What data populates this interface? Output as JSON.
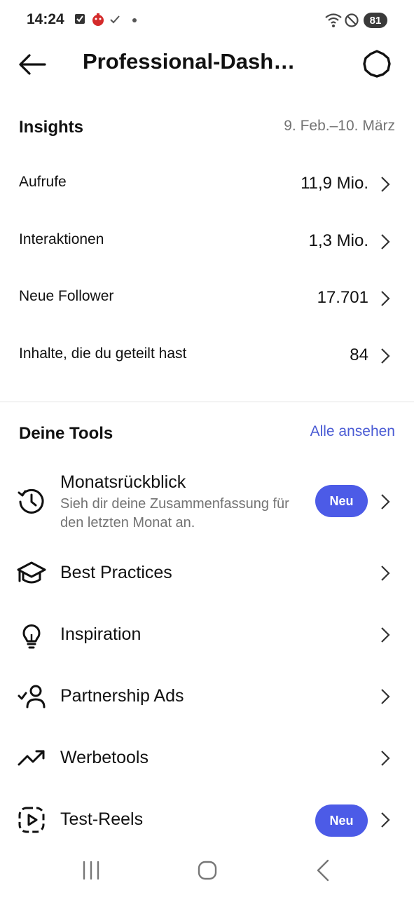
{
  "status_bar": {
    "time": "14:24",
    "battery": "81"
  },
  "header": {
    "title": "Professional-Dash…"
  },
  "insights": {
    "title": "Insights",
    "date_range": "9. Feb.–10. März",
    "metrics": [
      {
        "label": "Aufrufe",
        "value": "11,9 Mio."
      },
      {
        "label": "Interaktionen",
        "value": "1,3 Mio."
      },
      {
        "label": "Neue Follower",
        "value": "17.701"
      },
      {
        "label": "Inhalte, die du geteilt hast",
        "value": "84"
      }
    ]
  },
  "tools": {
    "title": "Deine Tools",
    "see_all": "Alle ansehen",
    "items": [
      {
        "label": "Monatsrückblick",
        "subtitle": "Sieh dir deine Zusammenfassung für den letzten Monat an.",
        "badge": "Neu",
        "icon": "history-icon"
      },
      {
        "label": "Best Practices",
        "icon": "graduation-cap-icon"
      },
      {
        "label": "Inspiration",
        "icon": "lightbulb-icon"
      },
      {
        "label": "Partnership Ads",
        "icon": "partnership-user-icon"
      },
      {
        "label": "Werbetools",
        "icon": "trending-up-icon"
      },
      {
        "label": "Test-Reels",
        "badge": "Neu",
        "icon": "reel-play-icon"
      }
    ]
  },
  "colors": {
    "accent": "#4c5be7",
    "link": "#4a5bd4",
    "secondary_text": "#737373"
  }
}
